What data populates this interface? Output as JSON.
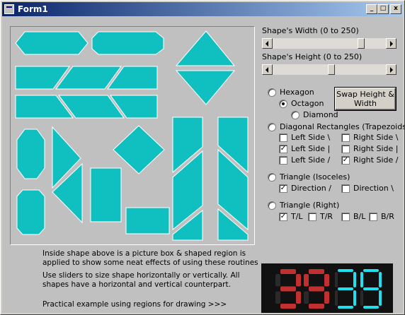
{
  "window": {
    "title": "Form1",
    "minimize": "_",
    "maximize": "□",
    "close": "x"
  },
  "sliders": {
    "width": {
      "label": "Shape's Width (0 to 250)",
      "value": 0.8
    },
    "height": {
      "label": "Shape's Height (0 to 250)",
      "value": 0.52
    }
  },
  "options": {
    "hexagon": "Hexagon",
    "octagon": "Octagon",
    "diamond": "Diamond",
    "diagonal": "Diagonal Rectangles (Trapezoids)",
    "left_side_back": "Left Side \\",
    "right_side_back": "Right Side \\",
    "left_side_bar": "Left Side |",
    "right_side_bar": "Right Side |",
    "left_side_fwd": "Left Side /",
    "right_side_fwd": "Right Side /",
    "triangle_iso": "Triangle (Isoceles)",
    "direction_fwd": "Direction /",
    "direction_back": "Direction \\",
    "triangle_right": "Triangle (Right)",
    "tl": "T/L",
    "tr": "T/R",
    "bl": "B/L",
    "br": "B/R"
  },
  "swap_button": "Swap Height & Width",
  "notes": {
    "line1": "Inside shape above is a picture box & shaped region is",
    "line2": "applied to show some neat effects of using these routines",
    "line3": "Use sliders to size shape horizontally or vertically.  All",
    "line4": "shapes have a horizontal and vertical counterpart.",
    "line5": "Practical example using  regions for drawing >>>"
  },
  "counter": {
    "left": "39",
    "right": "39"
  },
  "colors": {
    "shape_fill": "#10c0c0",
    "digit_red": "#c03030",
    "digit_cyan": "#20e0f0"
  },
  "icons": {
    "window": "app-icon"
  }
}
